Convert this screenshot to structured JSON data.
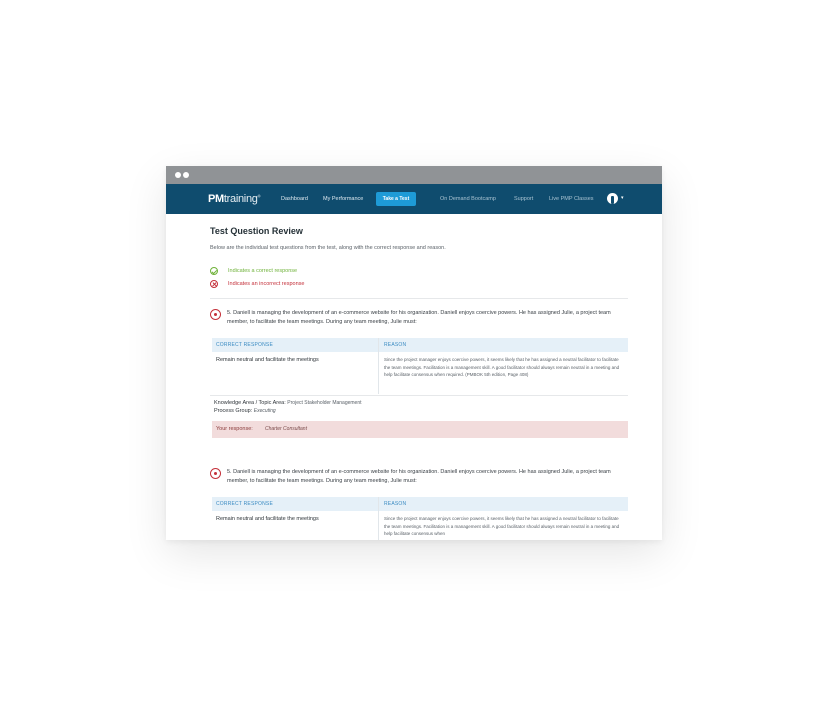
{
  "nav": {
    "logo_bold": "PM",
    "logo_rest": "training",
    "logo_mark": "®",
    "dashboard": "Dashboard",
    "my_performance": "My Performance",
    "take_test": "Take a Test",
    "on_demand": "On Demand Bootcamp",
    "support": "Support",
    "live_pmp": "Live PMP Classes",
    "caret": "▾"
  },
  "page": {
    "title": "Test Question Review",
    "intro": "Below are the individual test questions from the test, along with the correct response and reason.",
    "legend_correct": "Indicates a correct response",
    "legend_incorrect": "Indicates an incorrect response"
  },
  "table_headers": {
    "correct_response": "CORRECT RESPONSE",
    "reason": "REASON"
  },
  "questions": [
    {
      "text": "5. Daniell is managing the development of an e-commerce website for his organization. Daniell enjoys coercive powers. He has assigned Julie, a project team member, to facilitate the team meetings. During any team meeting, Julie must:",
      "correct_response": "Remain neutral and facilitate the meetings",
      "reason": "Since the project manager enjoys coercive powers, it seems likely that he has assigned a neutral facilitator to facilitate the team meetings. Facilitation is a management skill. A good facilitator should always remain neutral in a meeting and help facilitate consensus when required. (PMBOK 5th edition, Page 408)",
      "knowledge_area_label": "Knowledge Area / Topic Area:",
      "knowledge_area": "Project Stakeholder Management",
      "process_group_label": "Process Group:",
      "process_group": "Executing",
      "your_response_label": "Your response:",
      "your_response": "Charter Consultant"
    },
    {
      "text": "5. Daniell is managing the development of an e-commerce website for his organization. Daniell enjoys coercive powers. He has assigned Julie, a project team member, to facilitate the team meetings. During any team meeting, Julie must:",
      "correct_response": "Remain neutral and facilitate the meetings",
      "reason": "Since the project manager enjoys coercive powers, it seems likely that he has assigned a neutral facilitator to facilitate the team meetings. Facilitation is a management skill. A good facilitator should always remain neutral in a meeting and help facilitate consensus when"
    }
  ]
}
